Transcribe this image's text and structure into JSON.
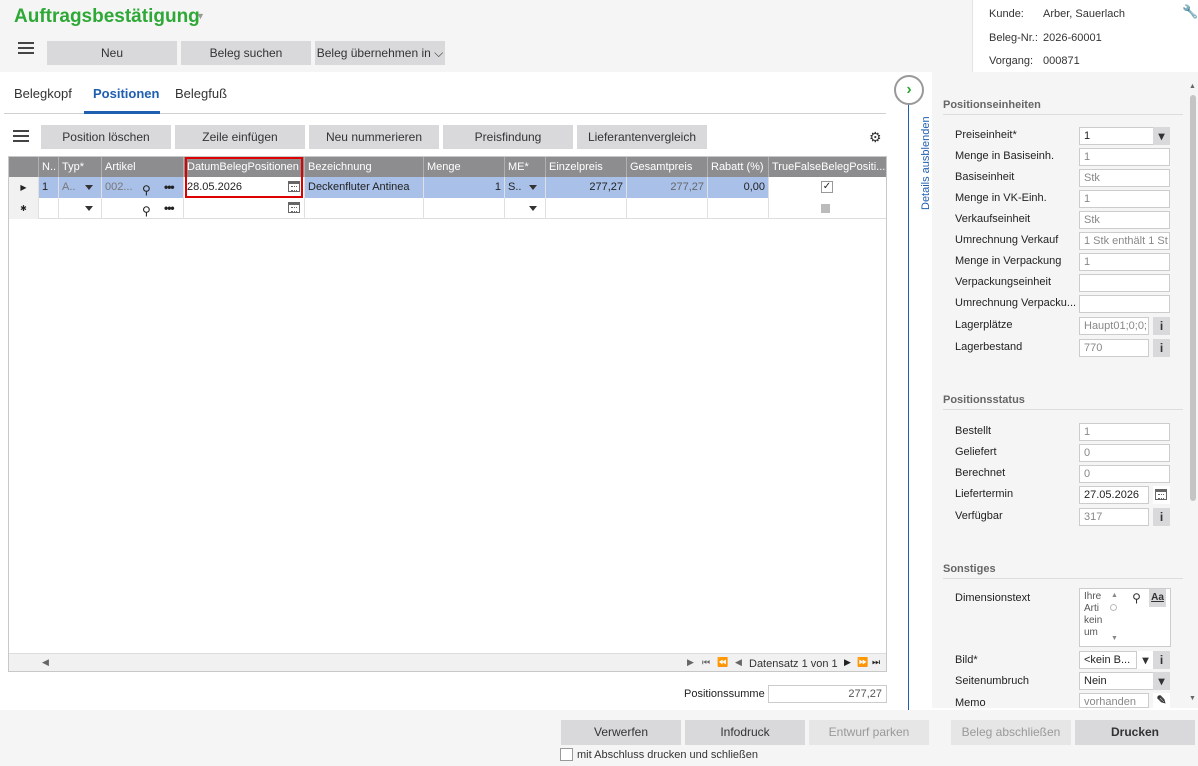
{
  "header": {
    "title": "Auftragsbestätigung",
    "buttons": {
      "neu": "Neu",
      "beleg_suchen": "Beleg suchen",
      "beleg_uebernehmen": "Beleg übernehmen in"
    }
  },
  "info": {
    "kunde_label": "Kunde:",
    "kunde_value": "Arber, Sauerlach",
    "belegnr_label": "Beleg-Nr.:",
    "belegnr_value": "2026-60001",
    "vorgang_label": "Vorgang:",
    "vorgang_value": "000871"
  },
  "tabs": {
    "belegkopf": "Belegkopf",
    "positionen": "Positionen",
    "belegfuss": "Belegfuß"
  },
  "grid_toolbar": {
    "pos_loeschen": "Position löschen",
    "zeile_einfuegen": "Zeile einfügen",
    "neu_nummerieren": "Neu nummerieren",
    "preisfindung": "Preisfindung",
    "lieferantenvergleich": "Lieferantenvergleich"
  },
  "grid": {
    "columns": {
      "n": "N..",
      "typ": "Typ*",
      "artikel": "Artikel",
      "datum": "DatumBelegPositionen",
      "bezeichnung": "Bezeichnung",
      "menge": "Menge",
      "me": "ME*",
      "einzelpreis": "Einzelpreis",
      "gesamtpreis": "Gesamtpreis",
      "rabatt": "Rabatt (%)",
      "truefalse": "TrueFalseBelegPositi..."
    },
    "row1": {
      "n": "1",
      "typ": "A..",
      "artikel": "002...",
      "datum": "28.05.2026",
      "bezeichnung": "Deckenfluter Antinea",
      "menge": "1",
      "me": "S..",
      "einzelpreis": "277,27",
      "gesamtpreis": "277,27",
      "rabatt": "0,00",
      "truefalse": "✓"
    },
    "new_row_marker": "✱",
    "navigator": "Datensatz 1 von 1"
  },
  "positionssumme": {
    "label": "Positionssumme",
    "value": "277,27"
  },
  "side": {
    "toggle_label": "Details ausblenden",
    "sec1": "Positionseinheiten",
    "preiseinheit_label": "Preiseinheit*",
    "preiseinheit": "1",
    "menge_basis_label": "Menge in Basiseinh.",
    "menge_basis": "1",
    "basiseinheit_label": "Basiseinheit",
    "basiseinheit": "Stk",
    "menge_vk_label": "Menge in VK-Einh.",
    "menge_vk": "1",
    "verkaufseinheit_label": "Verkaufseinheit",
    "verkaufseinheit": "Stk",
    "umrechnung_vk_label": "Umrechnung Verkauf",
    "umrechnung_vk": "1 Stk enthält 1 St",
    "menge_verp_label": "Menge in Verpackung",
    "menge_verp": "1",
    "verpackungseinheit_label": "Verpackungseinheit",
    "verpackungseinheit": "",
    "umrechnung_verp_label": "Umrechnung Verpacku...",
    "umrechnung_verp": "",
    "lagerplaetze_label": "Lagerplätze",
    "lagerplaetze": "Haupt01;0;0;",
    "lagerbestand_label": "Lagerbestand",
    "lagerbestand": "770",
    "sec2": "Positionsstatus",
    "bestellt_label": "Bestellt",
    "bestellt": "1",
    "geliefert_label": "Geliefert",
    "geliefert": "0",
    "berechnet_label": "Berechnet",
    "berechnet": "0",
    "liefertermin_label": "Liefertermin",
    "liefertermin": "27.05.2026",
    "verfuegbar_label": "Verfügbar",
    "verfuegbar": "317",
    "sec3": "Sonstiges",
    "dimensionstext_label": "Dimensionstext",
    "dimensionstext_lines": [
      "Ihre",
      "Arti",
      "kein",
      "um"
    ],
    "bild_label": "Bild*",
    "bild": "<kein B...",
    "seitenumbruch_label": "Seitenumbruch",
    "seitenumbruch": "Nein",
    "memo_label": "Memo",
    "memo": "vorhanden"
  },
  "bottom": {
    "verwerfen": "Verwerfen",
    "infodruck": "Infodruck",
    "entwurf": "Entwurf parken",
    "abschliessen": "Beleg abschließen",
    "drucken": "Drucken",
    "checkbox_label": "mit Abschluss drucken und schließen"
  }
}
